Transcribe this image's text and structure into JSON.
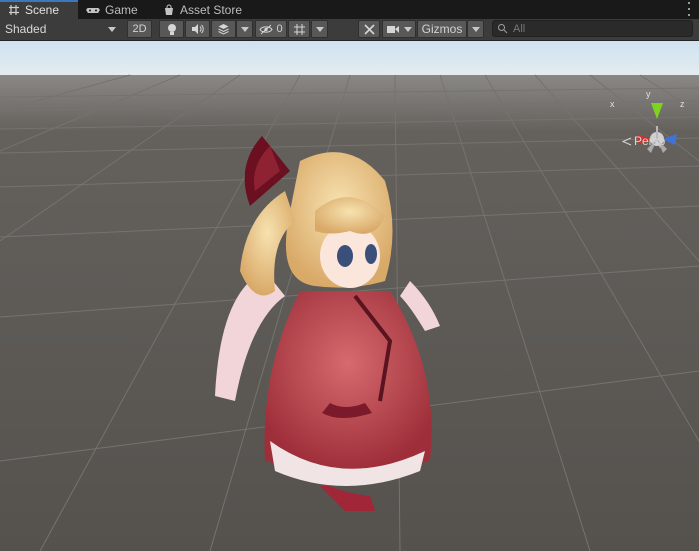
{
  "tabs": [
    {
      "label": "Scene",
      "icon": "grid-icon",
      "active": true
    },
    {
      "label": "Game",
      "icon": "gamepad-icon",
      "active": false
    },
    {
      "label": "Asset Store",
      "icon": "shopping-bag-icon",
      "active": false
    }
  ],
  "toolbar": {
    "shading_mode": "Shaded",
    "mode_2d": "2D",
    "hidden_count": "0",
    "gizmos_label": "Gizmos",
    "search_placeholder": "All"
  },
  "scene_gizmo": {
    "axis_y": "y",
    "axis_x": "x",
    "axis_z": "z",
    "projection": "Persp",
    "colors": {
      "y": "#7ed321",
      "x": "#d0302a",
      "z": "#3f73d8"
    }
  },
  "viewport": {
    "sky_color": "#cfe2f0",
    "ground_color": "#5a5753",
    "grid_color": "#6f6c68"
  }
}
